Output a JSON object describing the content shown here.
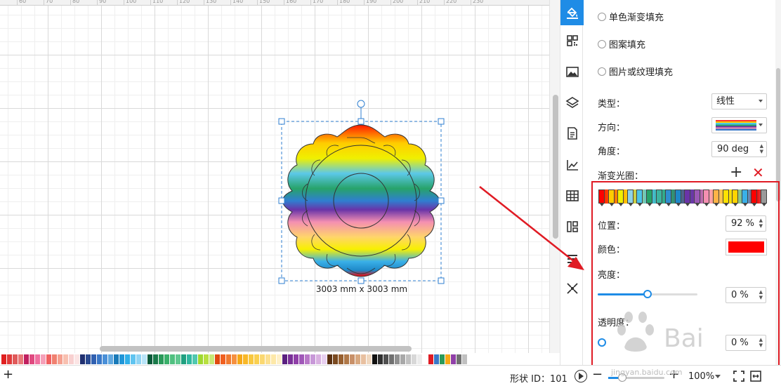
{
  "canvas": {
    "ruler_labels": [
      "50",
      "60",
      "70",
      "80",
      "90",
      "100",
      "110",
      "120",
      "130",
      "140",
      "150",
      "160",
      "170",
      "180",
      "190",
      "200",
      "210",
      "220",
      "230"
    ],
    "shape_size_label": "3003 mm x 3003 mm"
  },
  "toolbar": {
    "items": [
      {
        "name": "fill-icon"
      },
      {
        "name": "style-grid-icon"
      },
      {
        "name": "image-icon"
      },
      {
        "name": "layers-icon"
      },
      {
        "name": "document-icon"
      },
      {
        "name": "chart-icon"
      },
      {
        "name": "table-icon"
      },
      {
        "name": "org-chart-icon"
      },
      {
        "name": "menu-icon"
      },
      {
        "name": "fit-icon"
      }
    ]
  },
  "panel": {
    "radio_single_gradient": "单色渐变填充",
    "radio_pattern": "图案填充",
    "radio_picture": "图片或纹理填充",
    "type_label": "类型：",
    "type_value": "线性",
    "direction_label": "方向：",
    "angle_label": "角度：",
    "angle_value": "90 deg",
    "stops_label": "渐变光圈：",
    "position_label": "位置：",
    "position_value": "92 %",
    "color_label": "颜色：",
    "color_value": "#ff0000",
    "brightness_label": "亮度：",
    "brightness_value": "0 %",
    "brightness_fraction": 0.5,
    "transparency_label": "透明度：",
    "transparency_value": "0 %",
    "gradient_stops": [
      "#ff0000",
      "#ffcc00",
      "#f0f000",
      "#8ed2e8",
      "#4cc4e8",
      "#27a36a",
      "#3cb4a0",
      "#2f8fd0",
      "#1e88c8",
      "#6a34a8",
      "#9b59b6",
      "#f48fb1",
      "#ffb347",
      "#ffe100",
      "#ffd400",
      "#3ab0e8",
      "#ff0000",
      "#9a9a9a"
    ]
  },
  "status": {
    "shape_id": "形状 ID：101",
    "zoom": "100%"
  },
  "palette": [
    "#e02020",
    "#e03a3a",
    "#e05a5a",
    "#e87878",
    "#c02060",
    "#e04a80",
    "#f070a0",
    "#f5a0b8",
    "#f06060",
    "#f08070",
    "#f5a090",
    "#f8c0b0",
    "#f8d0d0",
    "#fbe4e4",
    "#203070",
    "#2a4a90",
    "#3060b0",
    "#3a78c8",
    "#4a90d8",
    "#60a8e0",
    "#1a7ab8",
    "#2096d8",
    "#30b0e8",
    "#60c4f0",
    "#90d4f4",
    "#b8e4f8",
    "#0a5a3a",
    "#1a7a4a",
    "#2a9a5a",
    "#3ab06a",
    "#50c080",
    "#60c890",
    "#20a080",
    "#30b8a0",
    "#50c8b0",
    "#a0d830",
    "#b8e040",
    "#c8e878",
    "#e04a10",
    "#f06020",
    "#f07a30",
    "#f59040",
    "#f5a818",
    "#f8b828",
    "#f8c840",
    "#fad050",
    "#fbd870",
    "#fce090",
    "#fde8a8",
    "#fef0c8",
    "#5a2080",
    "#7a3098",
    "#9040a8",
    "#a058b8",
    "#b878c8",
    "#c898d8",
    "#d8b0e0",
    "#e8d0f0",
    "#5a3010",
    "#7a4a20",
    "#986030",
    "#b07848",
    "#c89068",
    "#d8a880",
    "#e8c0a0",
    "#f0d8c0",
    "#101010",
    "#303030",
    "#505050",
    "#707070",
    "#909090",
    "#a8a8a8",
    "#c0c0c0",
    "#d8d8d8",
    "#ececec",
    "#ffffff",
    "#e01b24",
    "#3a78c8",
    "#2a9a5a",
    "#f5a818",
    "#9040a8",
    "#707070",
    "#c0c0c0"
  ]
}
